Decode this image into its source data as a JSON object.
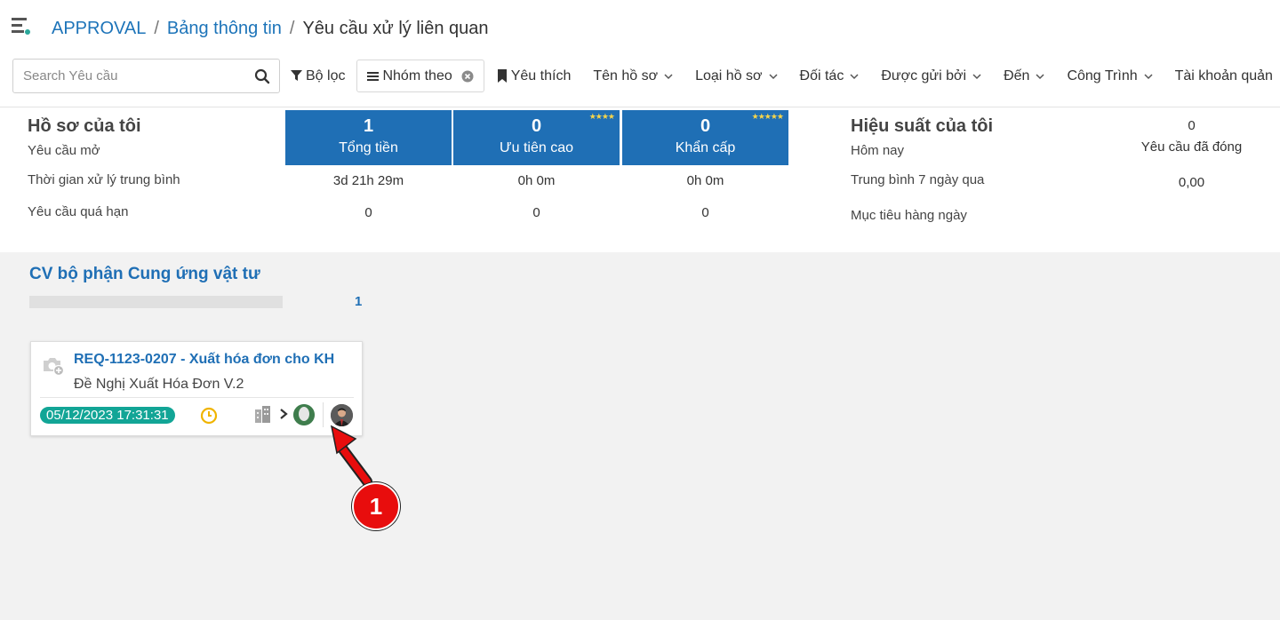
{
  "breadcrumb": {
    "root": "APPROVAL",
    "middle": "Bảng thông tin",
    "current": "Yêu cầu xử lý liên quan",
    "separator": "/"
  },
  "search": {
    "placeholder": "Search Yêu cầu",
    "value": ""
  },
  "toolbar": {
    "filter": "Bộ lọc",
    "group_by": "Nhóm theo",
    "favorites": "Yêu thích",
    "dropdowns": [
      "Tên hồ sơ",
      "Loại hồ sơ",
      "Đối tác",
      "Được gửi bởi",
      "Đến",
      "Công Trình",
      "Tài khoản quản"
    ]
  },
  "dashboard": {
    "my_title": "Hồ sơ của tôi",
    "row_labels": [
      "Yêu cầu mở",
      "Thời gian xử lý trung bình",
      "Yêu cầu quá hạn"
    ],
    "tiles": [
      {
        "count": "1",
        "label": "Tổng tiền",
        "stars": "",
        "avg": "3d 21h 29m",
        "overdue": "0"
      },
      {
        "count": "0",
        "label": "Ưu tiên cao",
        "stars": "★★★★",
        "avg": "0h 0m",
        "overdue": "0"
      },
      {
        "count": "0",
        "label": "Khẩn cấp",
        "stars": "★★★★★",
        "avg": "0h 0m",
        "overdue": "0"
      }
    ],
    "perf_title": "Hiệu suất của tôi",
    "perf_labels": [
      "Hôm nay",
      "Trung bình 7 ngày qua",
      "Mục tiêu hàng ngày"
    ],
    "closed_count": "0",
    "closed_label": "Yêu cầu đã đóng",
    "avg7": "0,00"
  },
  "board": {
    "column_title": "CV bộ phận Cung ứng vật tư",
    "column_count": "1",
    "progress": 0
  },
  "card": {
    "title": "REQ-1123-0207 - Xuất hóa đơn cho KH",
    "subtitle": "Đề Nghị Xuất Hóa Đơn V.2",
    "date": "05/12/2023 17:31:31"
  },
  "annotation": {
    "number": "1"
  },
  "colors": {
    "link": "#1d74b9",
    "tile": "#1f6fb5",
    "badge": "#12a596",
    "annotation": "#e80d0d"
  }
}
